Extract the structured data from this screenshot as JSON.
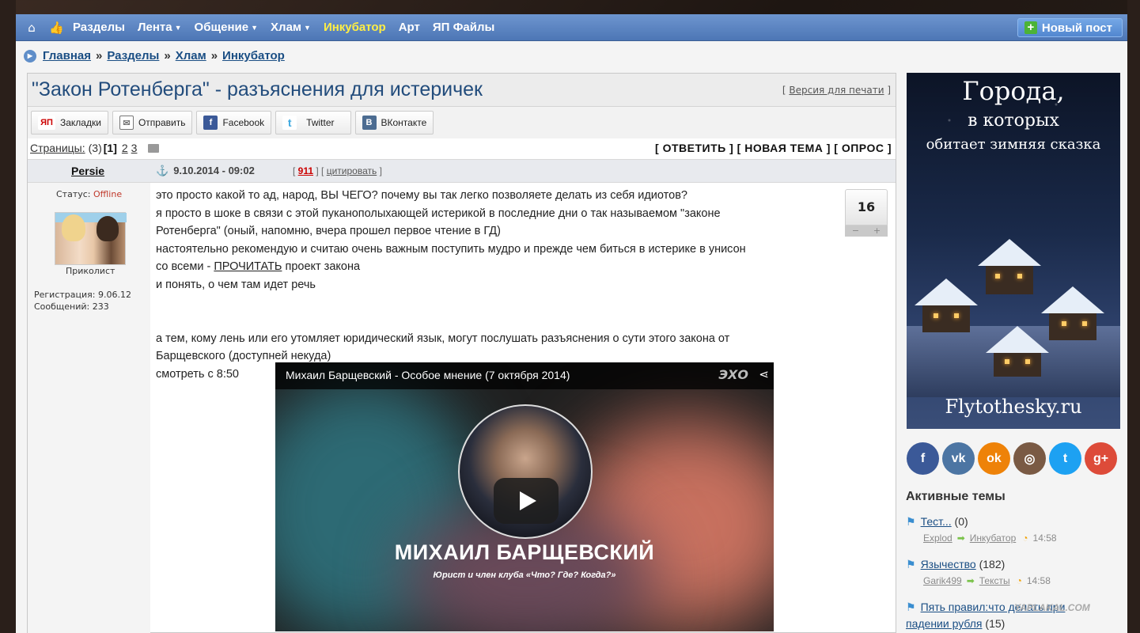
{
  "nav": {
    "home_icon": "home-icon",
    "like_icon": "thumbs-up-icon",
    "items": [
      "Разделы",
      "Лента",
      "Общение",
      "Хлам",
      "Инкубатор",
      "Арт",
      "ЯП Файлы"
    ],
    "new_post": "Новый пост"
  },
  "breadcrumb": {
    "items": [
      "Главная",
      "Разделы",
      "Хлам",
      "Инкубатор"
    ],
    "separator": "»"
  },
  "topic": {
    "title": "\"Закон Ротенберга\" - разъяснения для истеричек",
    "print_version": "Версия для печати"
  },
  "share": {
    "buttons": [
      "Закладки",
      "Отправить",
      "Facebook",
      "Twitter",
      "ВКонтакте"
    ],
    "yap_label": "ЯП"
  },
  "pages": {
    "label": "Страницы:",
    "count": "(3)",
    "current": "[1]",
    "p2": "2",
    "p3": "3"
  },
  "actions": "[ ОТВЕТИТЬ ] [ НОВАЯ ТЕМА ] [ ОПРОС ]",
  "post": {
    "author": "Persie",
    "date": "9.10.2014 - 09:02",
    "post_number": "911",
    "quote": "цитировать",
    "rating": "16",
    "lines": [
      "это просто какой то ад, народ, ВЫ ЧЕГО? почему вы так легко позволяете делать из себя идиотов?",
      "я просто в шоке в связи с этой пуканополыхающей истерикой в последние дни о так называемом \"законе",
      "Ротенберга\" (оный, напомню, вчера прошел первое чтение в ГД)",
      "настоятельно рекомендую и считаю очень важным поступить мудро и прежде чем биться в истерике в унисон",
      "со всеми - ",
      "ПРОЧИТАТЬ",
      " проект закона",
      "и понять, о чем там идет речь",
      "а тем, кому лень или его утомляет юридический язык, могут послушать разъяснения о сути этого закона от",
      "Барщевского (доступней некуда)",
      "смотреть с 8:50"
    ]
  },
  "user": {
    "status_label": "Статус:",
    "status": "Offline",
    "rank": "Приколист",
    "reg": "Регистрация: 9.06.12",
    "messages": "Сообщений: 233"
  },
  "video": {
    "title": "Михаил Барщевский - Особое мнение (7 октября 2014)",
    "name": "МИХАИЛ БАРЩЕВСКИЙ",
    "subtitle": "Юрист и член клуба «Что? Где? Когда?»",
    "logo": "ЭХО"
  },
  "ad": {
    "line1": "Города,",
    "line2": "в которых",
    "line3": "обитает зимняя сказка",
    "footer": "Flytothesky.ru"
  },
  "social": [
    {
      "label": "f",
      "color": "#3b5998"
    },
    {
      "label": "vk",
      "color": "#4c75a3"
    },
    {
      "label": "ok",
      "color": "#ee8208"
    },
    {
      "label": "◎",
      "color": "#7a5a44"
    },
    {
      "label": "t",
      "color": "#1da1f2"
    },
    {
      "label": "g+",
      "color": "#dd4b39"
    }
  ],
  "active": {
    "title": "Активные темы",
    "topics": [
      {
        "name": "Тест...",
        "count": "(0)",
        "user": "Explod",
        "section": "Инкубатор",
        "time": "14:58"
      },
      {
        "name": "Язычество",
        "count": "(182)",
        "user": "Garik499",
        "section": "Тексты",
        "time": "14:58"
      },
      {
        "name": "Пять правил:что делать при",
        "name2": "падении рубля",
        "count": "(15)"
      }
    ]
  },
  "watermark": "YAPLAKAL.COM"
}
